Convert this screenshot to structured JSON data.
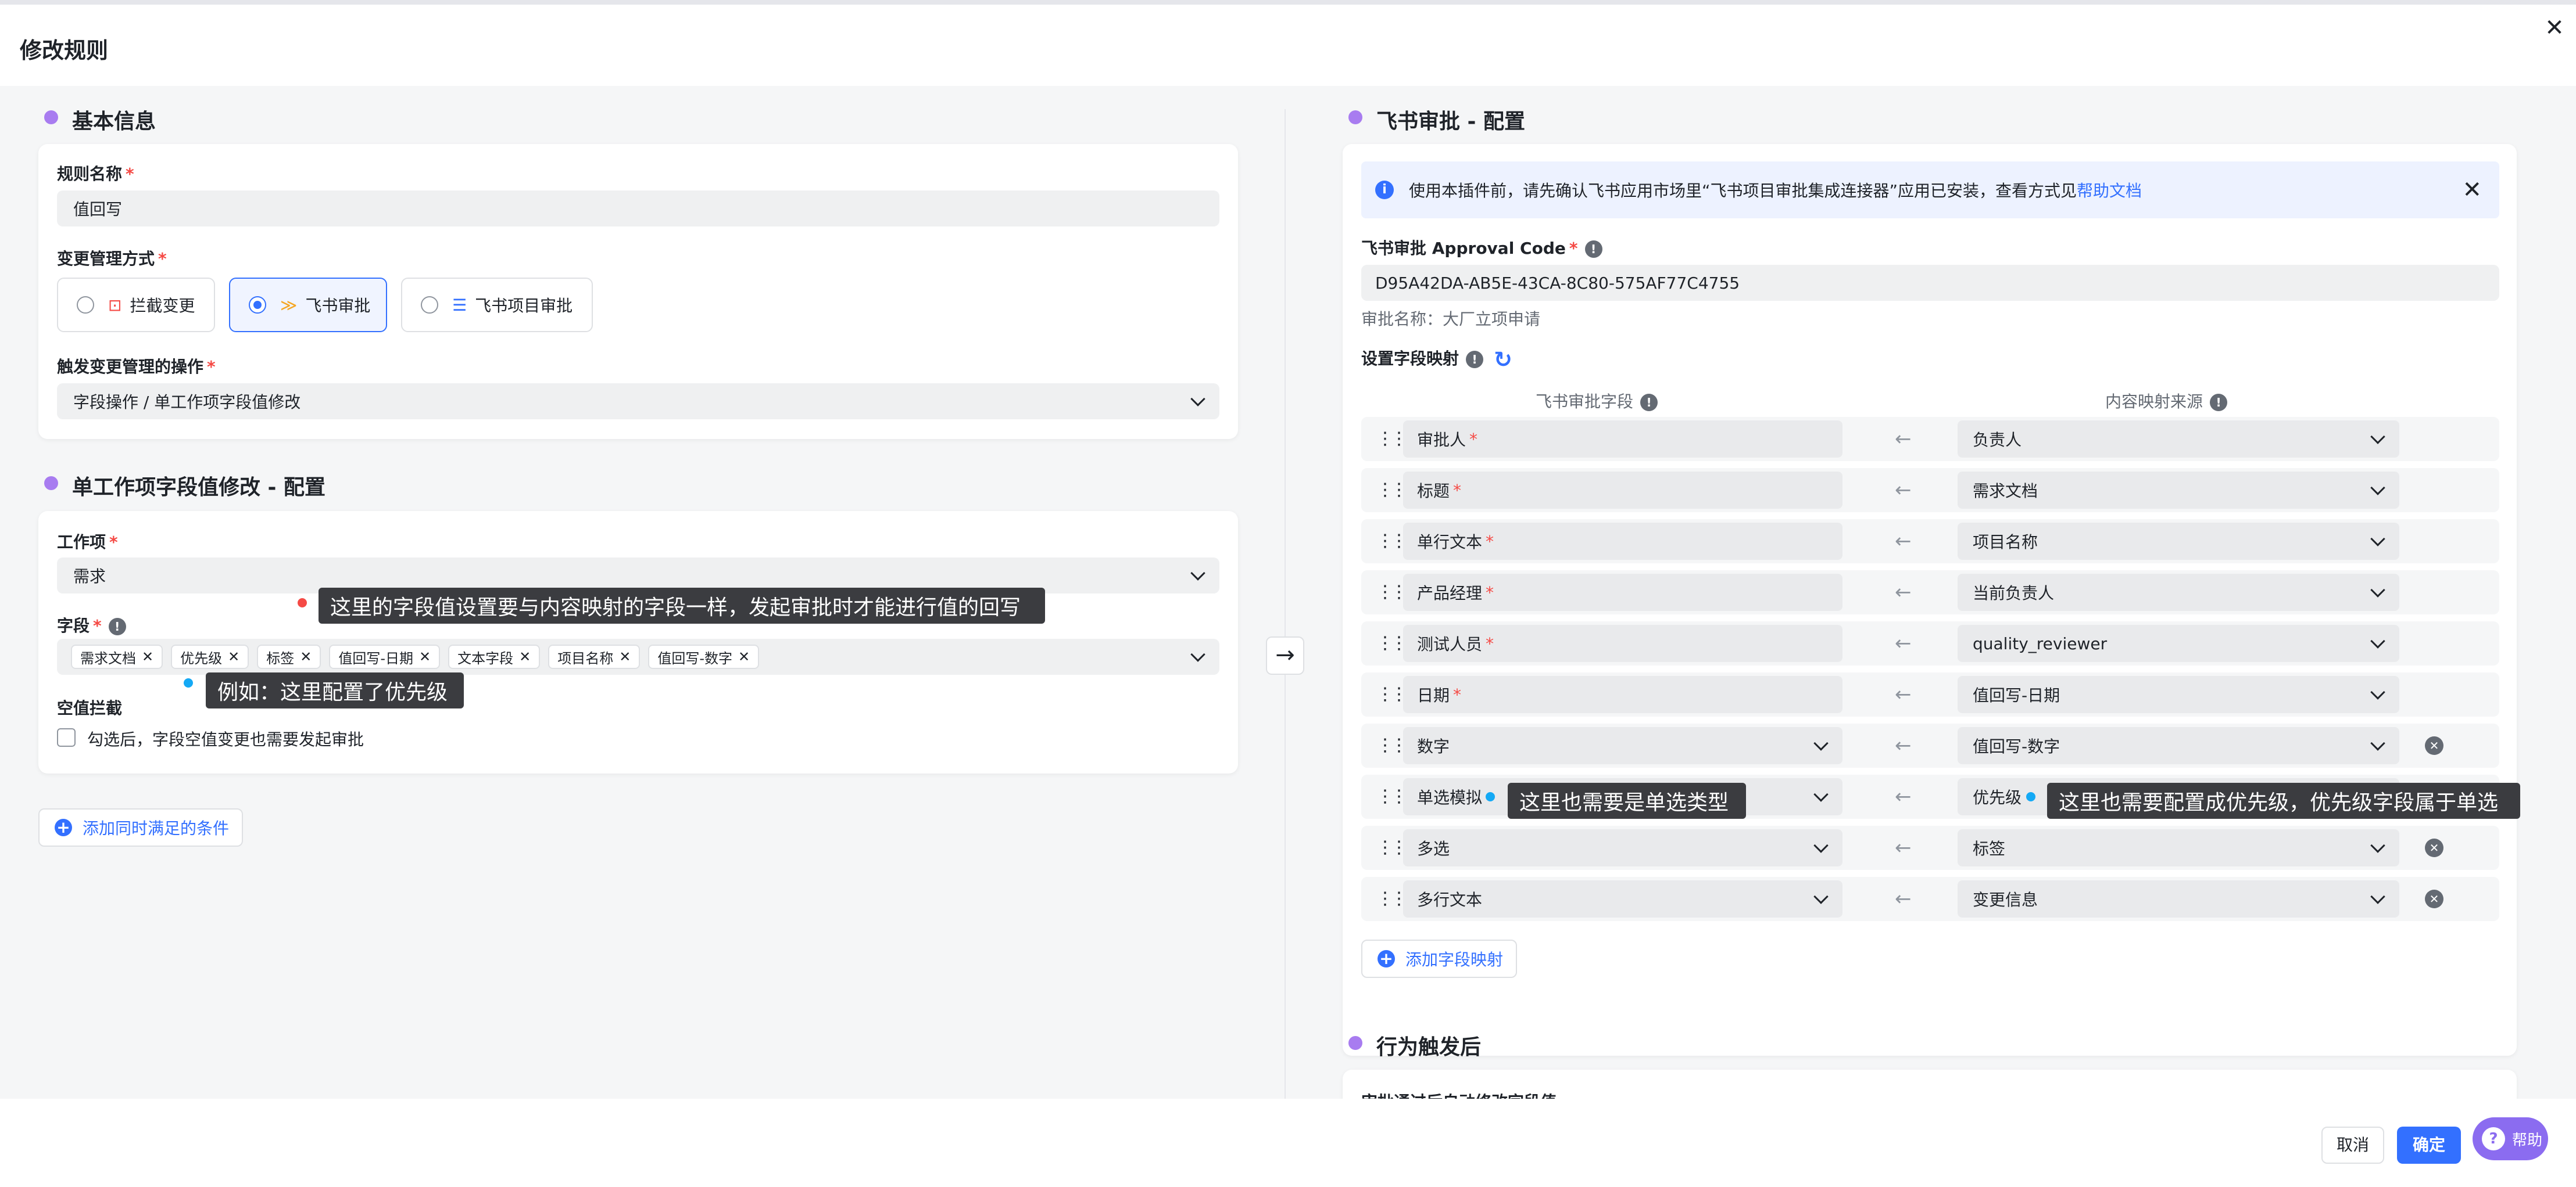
{
  "header": {
    "title": "修改规则",
    "close": "✕"
  },
  "basic": {
    "section_title": "基本信息",
    "rule_name_label": "规则名称",
    "rule_name_value": "值回写",
    "mode_label": "变更管理方式",
    "modes": [
      {
        "label": "拦截变更",
        "icon": "block-icon",
        "selected": false
      },
      {
        "label": "飞书审批",
        "icon": "feishu-approval-icon",
        "selected": true
      },
      {
        "label": "飞书项目审批",
        "icon": "list-icon",
        "selected": false
      }
    ],
    "trigger_label": "触发变更管理的操作",
    "trigger_value": "字段操作 / 单工作项字段值修改"
  },
  "single": {
    "section_title": "单工作项字段值修改 - 配置",
    "workitem_label": "工作项",
    "workitem_value": "需求",
    "field_label": "字段",
    "tags": [
      "需求文档",
      "优先级",
      "标签",
      "值回写-日期",
      "文本字段",
      "项目名称",
      "值回写-数字"
    ],
    "empty_label": "空值拦截",
    "empty_checkbox_text": "勾选后，字段空值变更也需要发起审批",
    "add_condition": "添加同时满足的条件"
  },
  "tooltips": {
    "t1": "这里的字段值设置要与内容映射的字段一样，发起审批时才能进行值的回写",
    "t2": "例如：这里配置了优先级",
    "t3": "这里也需要是单选类型",
    "t4": "这里也需要配置成优先级，优先级字段属于单选"
  },
  "feishu": {
    "section_title": "飞书审批 - 配置",
    "banner_text": "使用本插件前，请先确认飞书应用市场里“飞书项目审批集成连接器”应用已安装，查看方式见",
    "banner_link": "帮助文档",
    "code_label": "飞书审批 Approval Code",
    "code_value": "D95A42DA-AB5E-43CA-8C80-575AF77C4755",
    "approval_name": "审批名称：大厂立项申请",
    "mapping_label": "设置字段映射",
    "col_left": "飞书审批字段",
    "col_right": "内容映射来源",
    "rows": [
      {
        "left": "审批人",
        "req": true,
        "left_dd": false,
        "right": "负责人",
        "remove": false
      },
      {
        "left": "标题",
        "req": true,
        "left_dd": false,
        "right": "需求文档",
        "remove": false
      },
      {
        "left": "单行文本",
        "req": true,
        "left_dd": false,
        "right": "项目名称",
        "remove": false
      },
      {
        "left": "产品经理",
        "req": true,
        "left_dd": false,
        "right": "当前负责人",
        "remove": false
      },
      {
        "left": "测试人员",
        "req": true,
        "left_dd": false,
        "right": "quality_reviewer",
        "remove": false
      },
      {
        "left": "日期",
        "req": true,
        "left_dd": false,
        "right": "值回写-日期",
        "remove": false
      },
      {
        "left": "数字",
        "req": false,
        "left_dd": true,
        "right": "值回写-数字",
        "remove": true
      },
      {
        "left": "单选模拟",
        "req": false,
        "left_dd": true,
        "right": "优先级",
        "remove": true
      },
      {
        "left": "多选",
        "req": false,
        "left_dd": true,
        "right": "标签",
        "remove": true
      },
      {
        "left": "多行文本",
        "req": false,
        "left_dd": true,
        "right": "变更信息",
        "remove": true
      }
    ],
    "add_mapping": "添加字段映射"
  },
  "after": {
    "section_title": "行为触发后",
    "partial_text": "审批通过后自动修改字段值"
  },
  "footer": {
    "cancel": "取消",
    "ok": "确定",
    "help": "帮助"
  },
  "colors": {
    "accent": "#3370ff",
    "required": "#f54a45",
    "section_dot": "#a87cf0",
    "tooltip_bg": "#3b3c40"
  }
}
